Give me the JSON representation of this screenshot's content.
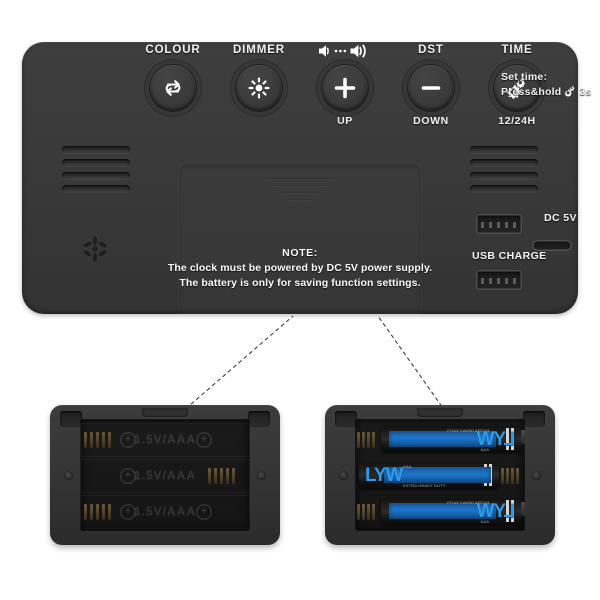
{
  "product": {
    "name": "Digital alarm clock rear control panel",
    "body_color": "#3a3a3a",
    "accent_color": "#2f9ae8"
  },
  "controls": [
    {
      "id": "colour",
      "label": "COLOUR",
      "icon": "cycle-arrows-icon",
      "sublabel": ""
    },
    {
      "id": "dimmer",
      "label": "DIMMER",
      "icon": "brightness-sun-icon",
      "sublabel": ""
    },
    {
      "id": "volume_up",
      "label": "",
      "icon": "plus-icon",
      "sublabel": "UP"
    },
    {
      "id": "volume_down",
      "label": "DST",
      "icon": "minus-icon",
      "sublabel": "DOWN"
    },
    {
      "id": "time",
      "label": "TIME",
      "icon": "gear-icon",
      "sublabel": "12/24H"
    }
  ],
  "volume_icon": {
    "name": "volume-range-icon",
    "label": "speaker low to speaker high"
  },
  "set_time_note": {
    "line1": "Set time:",
    "line2_prefix": "Press&hold",
    "line2_icon": "gear-icon",
    "line2_suffix": "3s"
  },
  "note": {
    "heading": "NOTE:",
    "line1": "The clock must be powered by DC 5V power supply.",
    "line2": "The battery is only for saving function settings."
  },
  "ports": [
    {
      "id": "usb_charge_top",
      "type": "usb-a-port",
      "label": ""
    },
    {
      "id": "usb_charge_bottom",
      "type": "usb-a-port",
      "label": "USB CHARGE"
    },
    {
      "id": "dc_5v",
      "type": "usb-c-port",
      "label": "DC 5V"
    }
  ],
  "grilles": {
    "left": {
      "name": "speaker-grille-left",
      "slots": 4
    },
    "right": {
      "name": "speaker-grille-right",
      "slots": 4
    },
    "vent": {
      "name": "vent-hole-icon"
    }
  },
  "battery_door": {
    "name": "battery-door",
    "grip_lines": 4
  },
  "compartments": [
    {
      "id": "empty",
      "title": "",
      "slots": [
        {
          "embossed": "1.5V/AAA",
          "polarity": "+",
          "spring_side": "left"
        },
        {
          "embossed": "1.5V/AAA",
          "polarity": "+",
          "spring_side": "right"
        },
        {
          "embossed": "1.5V/AAA",
          "polarity": "+",
          "spring_side": "left"
        }
      ]
    },
    {
      "id": "loaded",
      "title": "",
      "batteries": [
        {
          "brand": "LYW",
          "size": "AAA",
          "voltage": "1.5V",
          "orientation": "reversed",
          "sub": "EXTRA HEAVY DUTY"
        },
        {
          "brand": "LYW",
          "size": "AAA",
          "voltage": "1.5V",
          "orientation": "normal",
          "sub": "EXTRA HEAVY DUTY"
        },
        {
          "brand": "LYW",
          "size": "AAA",
          "voltage": "1.5V",
          "orientation": "reversed",
          "sub": "EXTRA HEAVY DUTY"
        }
      ]
    }
  ]
}
